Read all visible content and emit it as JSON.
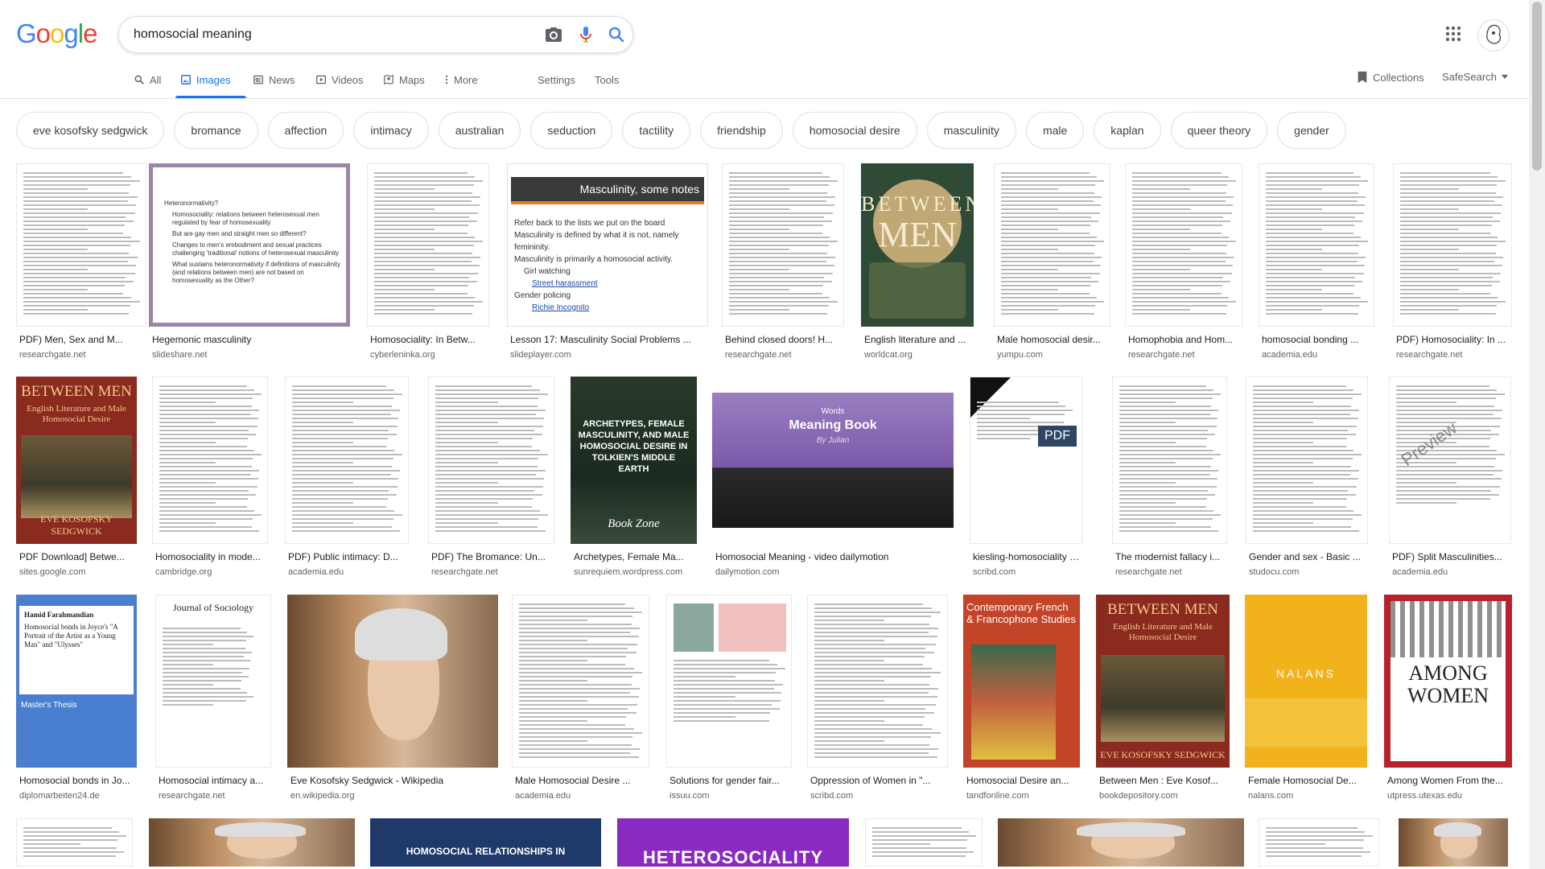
{
  "logo": {
    "letters": [
      "G",
      "o",
      "o",
      "g",
      "l",
      "e"
    ],
    "colors": [
      "#4285f4",
      "#ea4335",
      "#fbbc05",
      "#4285f4",
      "#34a853",
      "#ea4335"
    ]
  },
  "search": {
    "query": "homosocial meaning"
  },
  "tabs": [
    "All",
    "Images",
    "News",
    "Videos",
    "Maps",
    "More"
  ],
  "settings_label": "Settings",
  "tools_label": "Tools",
  "collections_label": "Collections",
  "safesearch_label": "SafeSearch",
  "chips": [
    "eve kosofsky sedgwick",
    "bromance",
    "affection",
    "intimacy",
    "australian",
    "seduction",
    "tactility",
    "friendship",
    "homosocial desire",
    "masculinity",
    "male",
    "kaplan",
    "queer theory",
    "gender"
  ],
  "row1": [
    {
      "title": "PDF) Men, Sex and M...",
      "source": "researchgate.net"
    },
    {
      "title": "Hegemonic masculinity",
      "source": "slideshare.net"
    },
    {
      "title": "Homosociality: In Betw...",
      "source": "cyberleninka.org"
    },
    {
      "title": "Lesson 17: Masculinity Social Problems ...",
      "source": "slideplayer.com"
    },
    {
      "title": "Behind closed doors! H...",
      "source": "researchgate.net"
    },
    {
      "title": "English literature and ...",
      "source": "worldcat.org"
    },
    {
      "title": "Male homosocial desir...",
      "source": "yumpu.com"
    },
    {
      "title": "Homophobia and Hom...",
      "source": "researchgate.net"
    },
    {
      "title": "homosocial bonding ...",
      "source": "academia.edu"
    },
    {
      "title": "PDF) Homosociality: In ...",
      "source": "researchgate.net"
    }
  ],
  "row2": [
    {
      "title": "PDF Download] Betwe...",
      "source": "sites.google.com"
    },
    {
      "title": "Homosociality in mode...",
      "source": "cambridge.org"
    },
    {
      "title": "PDF) Public intimacy: D...",
      "source": "academia.edu"
    },
    {
      "title": "PDF) The Bromance: Un...",
      "source": "researchgate.net"
    },
    {
      "title": "Archetypes, Female Ma...",
      "source": "sunrequiem.wordpress.com"
    },
    {
      "title": "Homosocial Meaning - video dailymotion",
      "source": "dailymotion.com"
    },
    {
      "title": "kiesling-homosociality | ...",
      "source": "scribd.com"
    },
    {
      "title": "The modernist fallacy i...",
      "source": "researchgate.net"
    },
    {
      "title": "Gender and sex - Basic ...",
      "source": "studocu.com"
    },
    {
      "title": "PDF) Split Masculinities...",
      "source": "academia.edu"
    }
  ],
  "row3": [
    {
      "title": "Homosocial bonds in Jo...",
      "source": "diplomarbeiten24.de"
    },
    {
      "title": "Homosocial intimacy a...",
      "source": "researchgate.net"
    },
    {
      "title": "Eve Kosofsky Sedgwick - Wikipedia",
      "source": "en.wikipedia.org"
    },
    {
      "title": "Male Homosocial Desire ...",
      "source": "academia.edu"
    },
    {
      "title": "Solutions for gender fair...",
      "source": "issuu.com"
    },
    {
      "title": "Oppression of Women in \"...",
      "source": "scribd.com"
    },
    {
      "title": "Homosocial Desire an...",
      "source": "tandfonline.com"
    },
    {
      "title": "Between Men : Eve Kosof...",
      "source": "bookdepository.com"
    },
    {
      "title": "Female Homosocial De...",
      "source": "nalans.com"
    },
    {
      "title": "Among Women From the...",
      "source": "utpress.utexas.edu"
    }
  ],
  "thumb_text": {
    "slide_heading": "Masculinity, some notes",
    "slide_bullets": [
      "Refer back to the lists we put on the board",
      "Masculinity is defined by what it is not, namely femininity.",
      "Masculinity is primarily a homosocial activity.",
      "Girl watching",
      "Street harassment",
      "Gender policing",
      "Richie Incognito"
    ],
    "hegemonic_bullets": [
      "Heteronormativity?",
      "Homosociality: relations between heterosexual men regulated by fear of homosexuality",
      "But are gay men and straight men so different?",
      "Changes to men's embodiment and sexual practices challenging 'traditional' notions of heterosexual masculinity",
      "What sustains heteronormativity if definitions of masculinity (and relations between men) are not based on homosexuality as the Other?"
    ],
    "between_men_cover": [
      "BETWEEN",
      "MEN"
    ],
    "between_men_red": [
      "BETWEEN MEN",
      "English Literature and Male Homosocial Desire",
      "EVE KOSOFSKY SEDGWICK"
    ],
    "archetypes": "ARCHETYPES, FEMALE MASCULINITY, AND MALE HOMOSOCIAL DESIRE IN TOLKIEN'S MIDDLE EARTH",
    "book_zone": "Book Zone",
    "words_logo": "Words",
    "meaning_book": "Meaning Book",
    "by_line": "By Julian",
    "pdf_badge": "PDF",
    "preview_stamp": "Preview",
    "journal_sociology": "Journal of Sociology",
    "contemporary_french": "Contemporary French & Francophone Studies",
    "nalans": "NALANS",
    "among_women": [
      "AMONG",
      "WOMEN"
    ],
    "heterosociality": "HETEROSOCIALITY",
    "homosocial_rel": "HOMOSOCIAL RELATIONSHIPS IN",
    "joyce_title": "Homosocial bonds in Joyce's \"A Portrait of the Artist as a Young Man\" and \"Ulysses\"",
    "hamid": "Hamid Farahmandian",
    "masters": "Master's Thesis"
  }
}
